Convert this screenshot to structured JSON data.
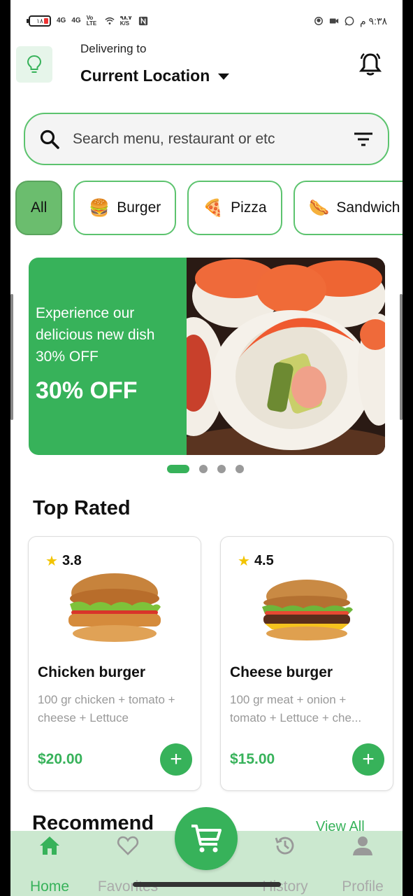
{
  "status_bar": {
    "battery": "١٨",
    "net1": "4G",
    "net2": "4G",
    "volte": "Vo LTE",
    "speed": "٩٨.٧ K/S",
    "time": "٩:٣٨ م"
  },
  "header": {
    "delivering_label": "Delivering to",
    "location": "Current Location"
  },
  "search": {
    "placeholder": "Search menu, restaurant or etc"
  },
  "categories": [
    {
      "label": "All",
      "emoji": ""
    },
    {
      "label": "Burger",
      "emoji": "🍔"
    },
    {
      "label": "Pizza",
      "emoji": "🍕"
    },
    {
      "label": "Sandwich",
      "emoji": "🌭"
    }
  ],
  "banner": {
    "text": "Experience our delicious new dish 30% OFF",
    "discount": "30% OFF",
    "active_index": 0,
    "total": 4
  },
  "top_rated": {
    "title": "Top Rated",
    "items": [
      {
        "rating": "3.8",
        "name": "Chicken burger",
        "desc": "100 gr chicken + tomato + cheese + Lettuce",
        "price": "$20.00"
      },
      {
        "rating": "4.5",
        "name": "Cheese burger",
        "desc": "100 gr meat + onion + tomato + Lettuce + che...",
        "price": "$15.00"
      }
    ]
  },
  "recommend": {
    "title": "Recommend",
    "view_all": "View All"
  },
  "bottom_nav": {
    "home": "Home",
    "favorites": "Favorites",
    "history": "History",
    "profile": "Profile"
  },
  "colors": {
    "accent": "#37b25a",
    "nav_bg": "#cbe8cf",
    "star": "#f2c400"
  }
}
